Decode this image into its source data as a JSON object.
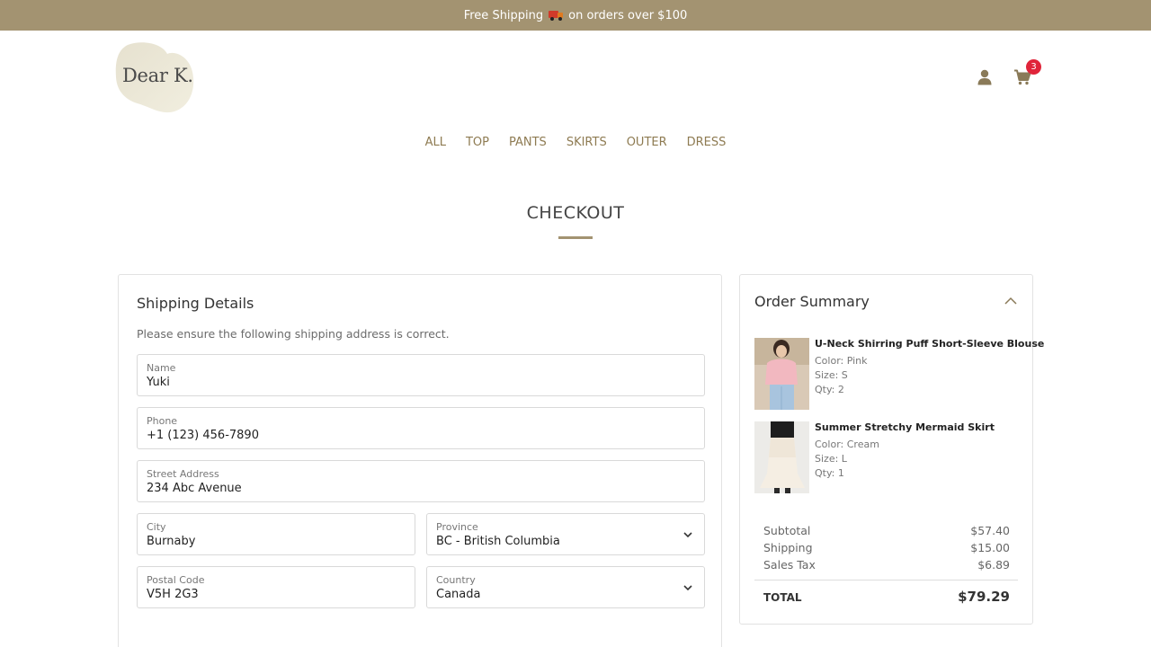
{
  "banner": {
    "text_before": "Free Shipping",
    "text_after": "on orders over $100",
    "icon": "delivery-truck-icon"
  },
  "brand": {
    "logo_text": "Dear K."
  },
  "header": {
    "user_icon": "user-icon",
    "cart_icon": "cart-icon",
    "cart_count": "3"
  },
  "nav": {
    "items": [
      "ALL",
      "TOP",
      "PANTS",
      "SKIRTS",
      "OUTER",
      "DRESS"
    ]
  },
  "page": {
    "title": "CHECKOUT"
  },
  "shipping": {
    "heading": "Shipping Details",
    "note": "Please ensure the following shipping address is correct.",
    "name": {
      "label": "Name",
      "value": "Yuki"
    },
    "phone": {
      "label": "Phone",
      "value": "+1 (123) 456-7890"
    },
    "street": {
      "label": "Street Address",
      "value": "234 Abc Avenue"
    },
    "city": {
      "label": "City",
      "value": "Burnaby"
    },
    "province": {
      "label": "Province",
      "value": "BC - British Columbia"
    },
    "postal": {
      "label": "Postal Code",
      "value": "V5H 2G3"
    },
    "country": {
      "label": "Country",
      "value": "Canada"
    }
  },
  "summary": {
    "heading": "Order Summary",
    "items": [
      {
        "name": "U-Neck Shirring Puff Short-Sleeve Blouse",
        "color": "Color: Pink",
        "size": "Size: S",
        "qty": "Qty: 2"
      },
      {
        "name": "Summer Stretchy Mermaid Skirt",
        "color": "Color: Cream",
        "size": "Size: L",
        "qty": "Qty: 1"
      }
    ],
    "subtotal_label": "Subtotal",
    "subtotal": "$57.40",
    "shipping_label": "Shipping",
    "shipping": "$15.00",
    "tax_label": "Sales Tax",
    "tax": "$6.89",
    "total_label": "TOTAL",
    "total": "$79.29"
  },
  "colors": {
    "accent": "#a39371",
    "nav_text": "#8e7b52",
    "badge": "#e0243a"
  }
}
